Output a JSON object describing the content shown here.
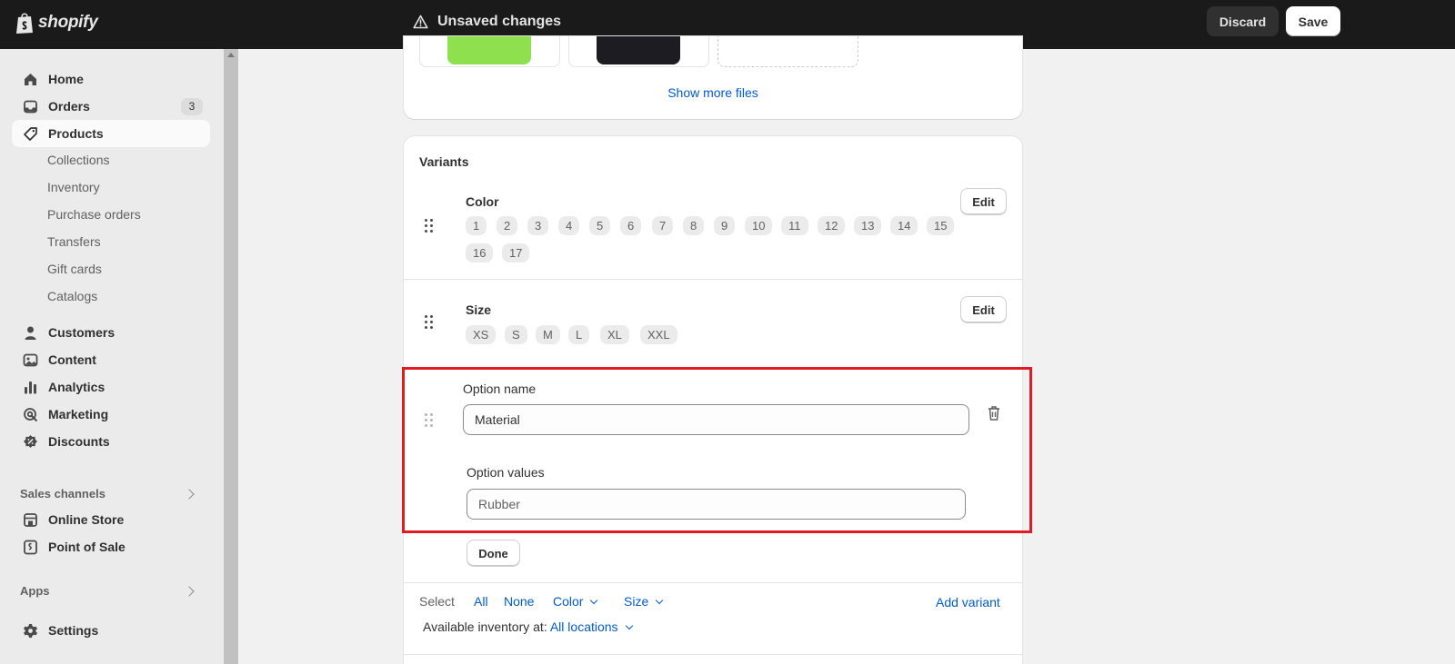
{
  "topbar": {
    "logo_text": "shopify",
    "status": "Unsaved changes",
    "discard_label": "Discard",
    "save_label": "Save"
  },
  "sidebar": {
    "items": [
      {
        "label": "Home",
        "icon": "home-icon"
      },
      {
        "label": "Orders",
        "icon": "inbox-icon",
        "badge": "3"
      },
      {
        "label": "Products",
        "icon": "tag-icon",
        "active": true
      }
    ],
    "product_subitems": [
      "Collections",
      "Inventory",
      "Purchase orders",
      "Transfers",
      "Gift cards",
      "Catalogs"
    ],
    "items2": [
      {
        "label": "Customers",
        "icon": "person-icon"
      },
      {
        "label": "Content",
        "icon": "image-icon"
      },
      {
        "label": "Analytics",
        "icon": "bar-chart-icon"
      },
      {
        "label": "Marketing",
        "icon": "target-icon"
      },
      {
        "label": "Discounts",
        "icon": "discount-icon"
      }
    ],
    "sales_channels_label": "Sales channels",
    "channels": [
      {
        "label": "Online Store",
        "icon": "store-icon"
      },
      {
        "label": "Point of Sale",
        "icon": "pos-icon"
      }
    ],
    "apps_label": "Apps",
    "settings_label": "Settings"
  },
  "media": {
    "show_more_label": "Show more files"
  },
  "variants": {
    "title": "Variants",
    "options": [
      {
        "name": "Color",
        "values": [
          "1",
          "2",
          "3",
          "4",
          "5",
          "6",
          "7",
          "8",
          "9",
          "10",
          "11",
          "12",
          "13",
          "14",
          "15",
          "16",
          "17"
        ],
        "edit_label": "Edit"
      },
      {
        "name": "Size",
        "values": [
          "XS",
          "S",
          "M",
          "L",
          "XL",
          "XXL"
        ],
        "edit_label": "Edit"
      }
    ],
    "new_option": {
      "name_label": "Option name",
      "name_value": "Material",
      "values_label": "Option values",
      "values_value": "Rubber",
      "done_label": "Done"
    },
    "select": {
      "label": "Select",
      "all": "All",
      "none": "None",
      "color": "Color",
      "size": "Size",
      "add_variant": "Add variant"
    },
    "inventory": {
      "label": "Available inventory at:",
      "location": "All locations"
    }
  },
  "colors": {
    "topbar_bg": "#1a1a1a",
    "link": "#005bd3",
    "highlight": "#e21b23"
  }
}
